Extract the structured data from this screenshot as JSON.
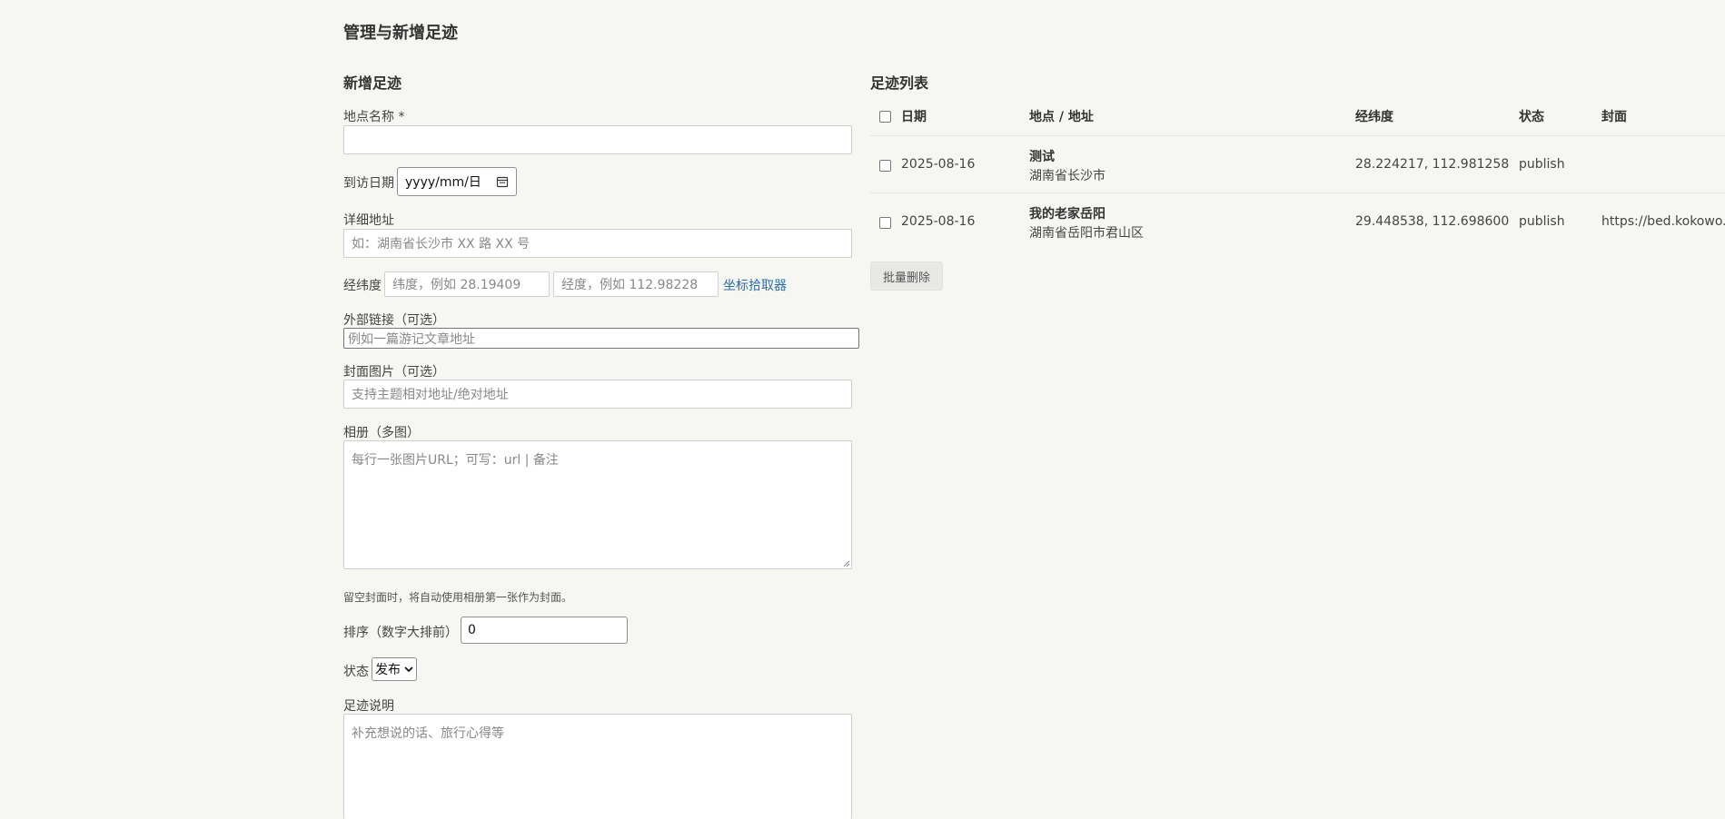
{
  "page": {
    "title": "管理与新增足迹"
  },
  "form": {
    "section_title": "新增足迹",
    "name_label": "地点名称 *",
    "name_value": "",
    "date_label": "到访日期",
    "date_placeholder": "yyyy/mm/日",
    "address_label": "详细地址",
    "address_placeholder": "如：湖南省长沙市 XX 路 XX 号",
    "coords_label": "经纬度",
    "lat_placeholder": "纬度，例如 28.19409",
    "lng_placeholder": "经度，例如 112.98228",
    "coords_picker": "坐标拾取器",
    "ext_label": "外部链接（可选）",
    "ext_placeholder": "例如一篇游记文章地址",
    "cover_label": "封面图片（可选）",
    "cover_placeholder": "支持主题相对地址/绝对地址",
    "album_label": "相册（多图）",
    "album_placeholder": "每行一张图片URL；可写：url | 备注",
    "cover_hint": "留空封面时，将自动使用相册第一张作为封面。",
    "sort_label": "排序（数字大排前）",
    "sort_value": "0",
    "status_label": "状态",
    "status_value": "发布",
    "desc_label": "足迹说明",
    "desc_placeholder": "补充想说的话、旅行心得等"
  },
  "list": {
    "section_title": "足迹列表",
    "columns": [
      "日期",
      "地点 / 地址",
      "经纬度",
      "状态",
      "封面"
    ],
    "rows": [
      {
        "date": "2025-08-16",
        "name": "测试",
        "address": "湖南省长沙市",
        "coords": "28.224217, 112.981258",
        "status": "publish",
        "cover": ""
      },
      {
        "date": "2025-08-16",
        "name": "我的老家岳阳",
        "address": "湖南省岳阳市君山区",
        "coords": "29.448538, 112.698600",
        "status": "publish",
        "cover": "https://bed.kokowo.cn"
      }
    ],
    "bulk_delete": "批量删除"
  },
  "icons": {
    "calendar": "calendar-icon",
    "dropdown": "chevron-down-icon",
    "resize": "resize-grip-icon"
  }
}
